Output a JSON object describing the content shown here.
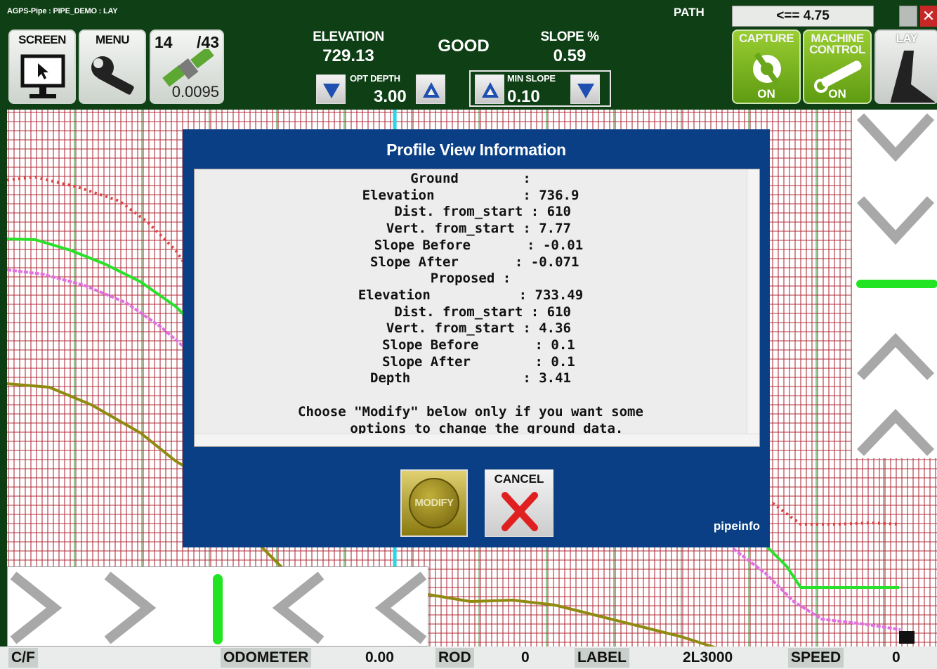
{
  "app": {
    "title": "AGPS-Pipe : PIPE_DEMO : LAY"
  },
  "toolbar": {
    "screen_label": "SCREEN",
    "menu_label": "MENU",
    "satellites": {
      "visible": "14",
      "total": "/43",
      "precision": "0.0095"
    },
    "elevation": {
      "label": "ELEVATION",
      "value": "729.13"
    },
    "status": "GOOD",
    "slope": {
      "label": "SLOPE %",
      "value": "0.59"
    },
    "opt_depth": {
      "label": "OPT DEPTH",
      "value": "3.00"
    },
    "min_slope": {
      "label": "MIN SLOPE",
      "value": "0.10"
    },
    "path": {
      "label": "PATH",
      "value": "<== 4.75"
    },
    "capture": {
      "label": "CAPTURE",
      "state": "ON"
    },
    "machine_control": {
      "label": "MACHINE CONTROL",
      "state": "ON"
    },
    "lay_label": "LAY",
    "close_label": "✕"
  },
  "dialog": {
    "title": "Profile View Information",
    "lines": [
      "Ground        :",
      "Elevation           : 736.9",
      "   Dist. from_start : 610",
      "  Vert. from_start : 7.77",
      "  Slope Before       : -0.01",
      " Slope After       : -0.071",
      "Proposed :",
      "Elevation           : 733.49",
      "   Dist. from_start : 610",
      "  Vert. from_start : 4.36",
      "  Slope Before       : 0.1",
      "  Slope After        : 0.1",
      "Depth              : 3.41",
      "",
      "Choose \"Modify\" below only if you want some",
      "    options to change the ground data."
    ],
    "modify_label": "MODIFY",
    "cancel_label": "CANCEL",
    "footer": "pipeinfo"
  },
  "statusbar": {
    "cf": "C/F",
    "odometer_label": "ODOMETER",
    "odometer_value": "0.00",
    "rod_label": "ROD",
    "rod_value": "0",
    "label_label": "LABEL",
    "label_value": "2L3000",
    "speed_label": "SPEED",
    "speed_value": "0"
  },
  "colors": {
    "topbar_bg": "#0f3f15",
    "dialog_bg": "#0a3f85",
    "grid_red": "#b0303c",
    "grid_green": "#60b060",
    "cursor_cyan": "#25d9e8",
    "ground_line": "#29e02a",
    "proposed_line": "#e070e0",
    "pipe_line": "#8f8a10",
    "red_dots": "#e04040"
  }
}
